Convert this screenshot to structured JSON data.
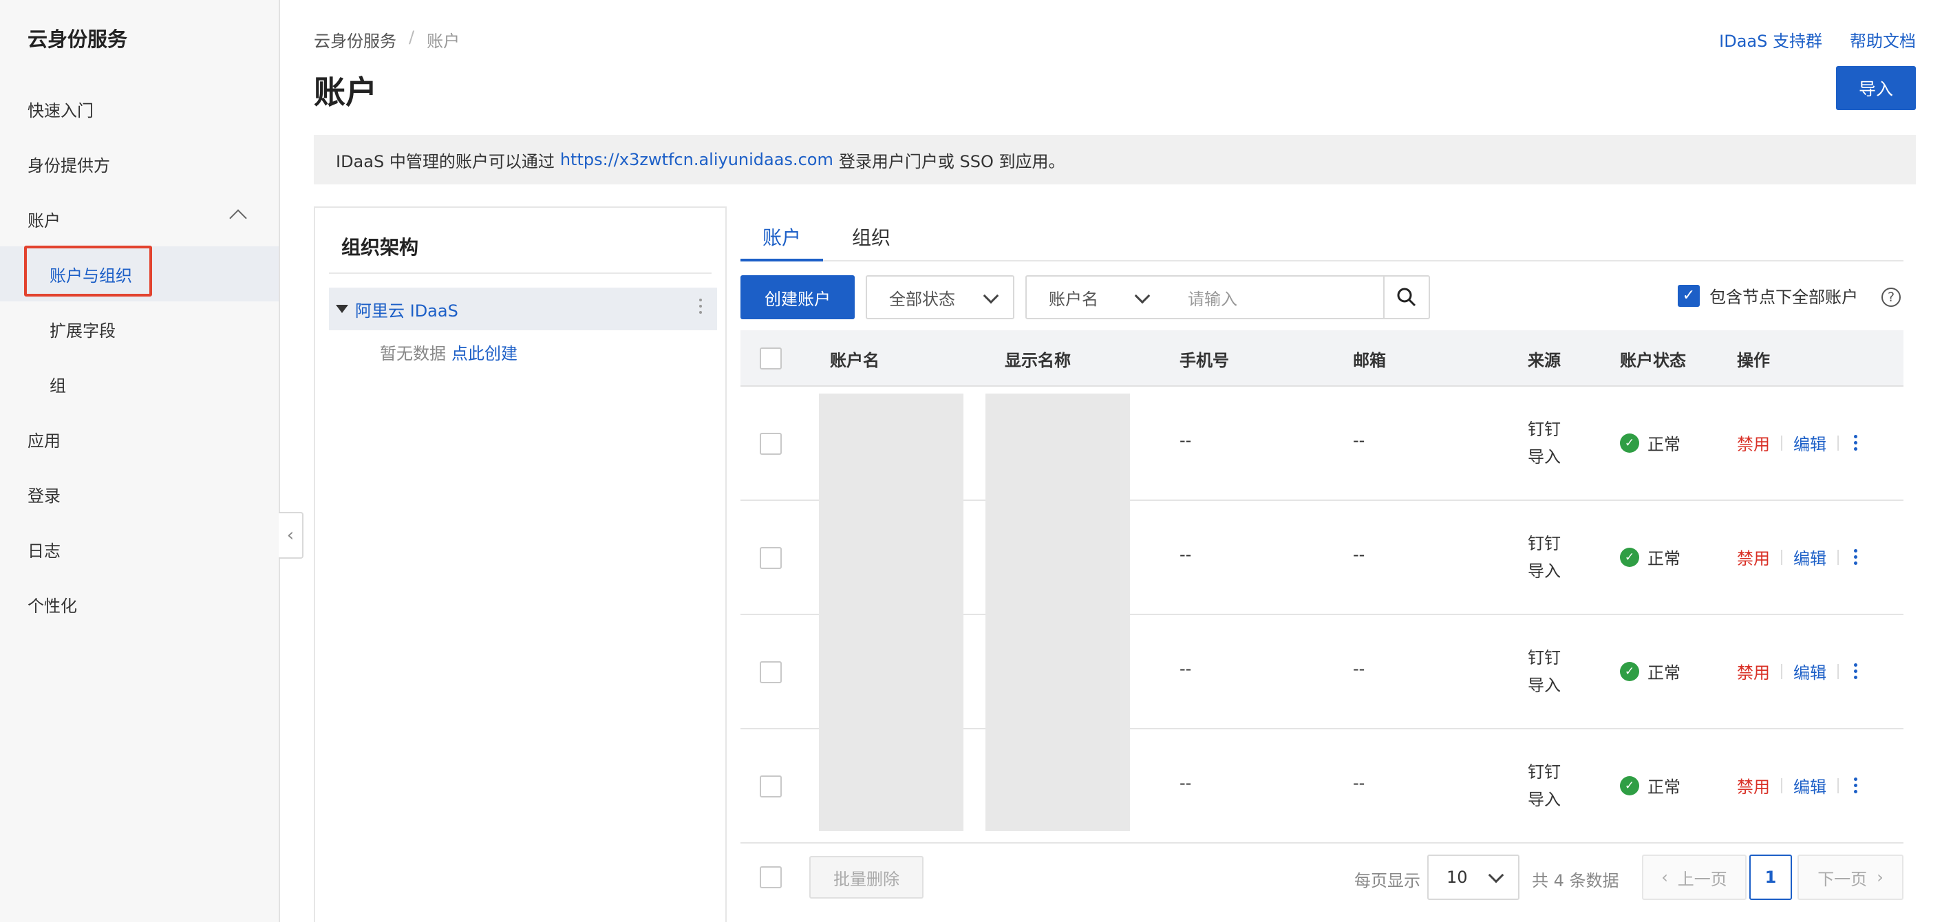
{
  "sidebar": {
    "title": "云身份服务",
    "items": [
      {
        "label": "快速入门"
      },
      {
        "label": "身份提供方"
      },
      {
        "label": "账户"
      },
      {
        "label": "账户与组织"
      },
      {
        "label": "扩展字段"
      },
      {
        "label": "组"
      },
      {
        "label": "应用"
      },
      {
        "label": "登录"
      },
      {
        "label": "日志"
      },
      {
        "label": "个性化"
      }
    ]
  },
  "header": {
    "breadcrumb": [
      "云身份服务",
      "/",
      "账户"
    ],
    "title": "账户",
    "links": [
      "IDaaS 支持群",
      "帮助文档"
    ],
    "import_label": "导入"
  },
  "notice": {
    "prefix": "IDaaS 中管理的账户可以通过",
    "url": "https://x3zwtfcn.aliyunidaas.com",
    "suffix": "登录用户门户或 SSO 到应用。"
  },
  "org_panel": {
    "title": "组织架构",
    "root": "阿里云 IDaaS",
    "empty_text": "暂无数据",
    "create_link": "点此创建"
  },
  "tabs": [
    "账户",
    "组织"
  ],
  "toolbar": {
    "create_label": "创建账户",
    "status_filter": "全部状态",
    "field_select": "账户名",
    "search_placeholder": "请输入",
    "include_all_label": "包含节点下全部账户",
    "help": "?"
  },
  "table": {
    "columns": [
      "账户名",
      "显示名称",
      "手机号",
      "邮箱",
      "来源",
      "账户状态",
      "操作"
    ],
    "rows": [
      {
        "phone": "--",
        "email": "--",
        "source_1": "钉钉",
        "source_2": "导入",
        "status": "正常",
        "op_disable": "禁用",
        "op_edit": "编辑"
      },
      {
        "phone": "--",
        "email": "--",
        "source_1": "钉钉",
        "source_2": "导入",
        "status": "正常",
        "op_disable": "禁用",
        "op_edit": "编辑"
      },
      {
        "phone": "--",
        "email": "--",
        "source_1": "钉钉",
        "source_2": "导入",
        "status": "正常",
        "op_disable": "禁用",
        "op_edit": "编辑"
      },
      {
        "phone": "--",
        "email": "--",
        "source_1": "钉钉",
        "source_2": "导入",
        "status": "正常",
        "op_disable": "禁用",
        "op_edit": "编辑"
      }
    ]
  },
  "footer": {
    "batch_delete": "批量删除",
    "per_page_label": "每页显示",
    "per_page_value": "10",
    "total_text": "共 4 条数据",
    "prev": "上一页",
    "current_page": "1",
    "next": "下一页"
  },
  "colors": {
    "accent": "#1c5fc7",
    "danger": "#d93026",
    "success": "#2f9e44",
    "highlight_box": "#e2432f"
  }
}
